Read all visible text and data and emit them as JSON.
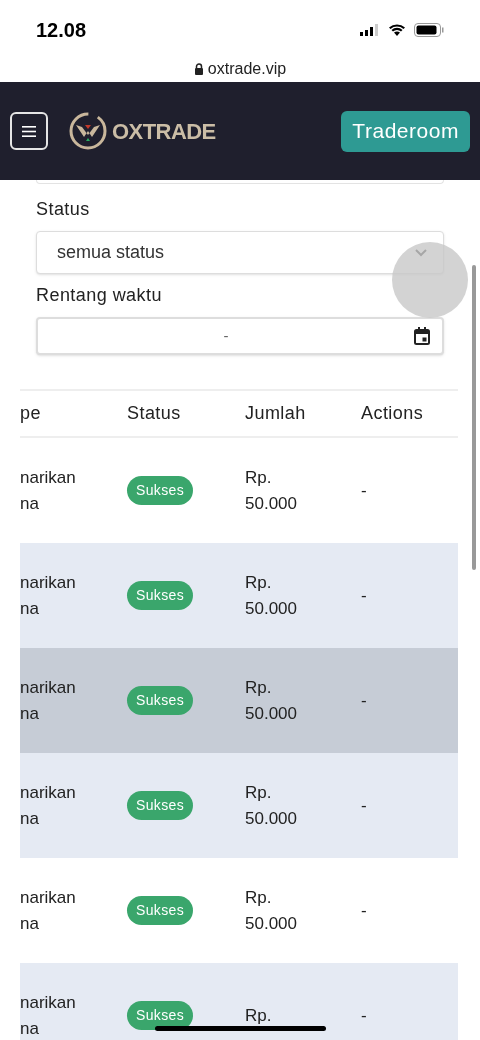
{
  "status_bar": {
    "time": "12.08"
  },
  "url_bar": {
    "address": "oxtrade.vip"
  },
  "navbar": {
    "logo_text": "OXTRADE",
    "button": "Traderoom"
  },
  "filters": [
    {
      "kind": "select",
      "label": "Status",
      "value": "semua status"
    },
    {
      "kind": "date",
      "label": "Rentang waktu",
      "value": "-"
    }
  ],
  "table": {
    "columns": [
      "pe",
      "Status",
      "Jumlah",
      "Actions"
    ],
    "rows": [
      {
        "column_1": "narikan na",
        "status": "Sukses",
        "amount": "Rp. 50.000",
        "actions": "-",
        "hovered": false
      },
      {
        "column_1": "narikan na",
        "status": "Sukses",
        "amount": "Rp. 50.000",
        "actions": "-",
        "hovered": false
      },
      {
        "column_1": "narikan na",
        "status": "Sukses",
        "amount": "Rp. 50.000",
        "actions": "-",
        "hovered": true
      },
      {
        "column_1": "narikan na",
        "status": "Sukses",
        "amount": "Rp. 50.000",
        "actions": "-",
        "hovered": false
      },
      {
        "column_1": "narikan na",
        "status": "Sukses",
        "amount": "Rp. 50.000",
        "actions": "-",
        "hovered": false
      },
      {
        "column_1": "narikan na",
        "status": "Sukses",
        "amount": "Rp.",
        "actions": "-",
        "hovered": false
      }
    ]
  }
}
